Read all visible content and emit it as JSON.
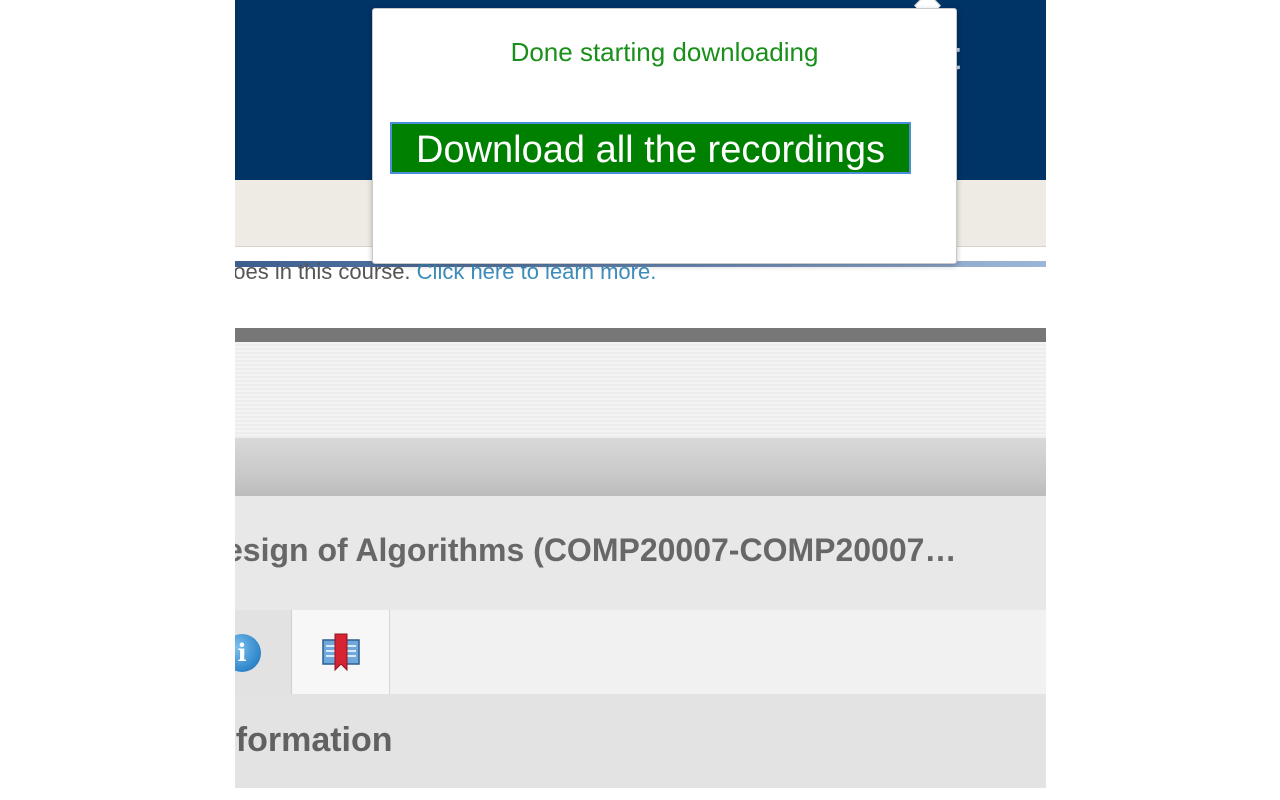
{
  "notice": {
    "text_start": "hoes in this course.",
    "link_text": "Click here to learn more."
  },
  "course": {
    "title": "esign of Algorithms (COMP20007-COMP20007…"
  },
  "tabs": [
    {
      "icon": "info-icon",
      "glyph": "i"
    },
    {
      "icon": "book-icon"
    }
  ],
  "section": {
    "heading": "nformation"
  },
  "popup": {
    "status": "Done starting downloading",
    "button_label": "Download all the recordings"
  },
  "navbar": {
    "partial_glyph": "t"
  },
  "colors": {
    "navbar": "#003366",
    "button_bg": "#008000",
    "status_text": "#1a8f1a",
    "link": "#3c8dbc"
  }
}
